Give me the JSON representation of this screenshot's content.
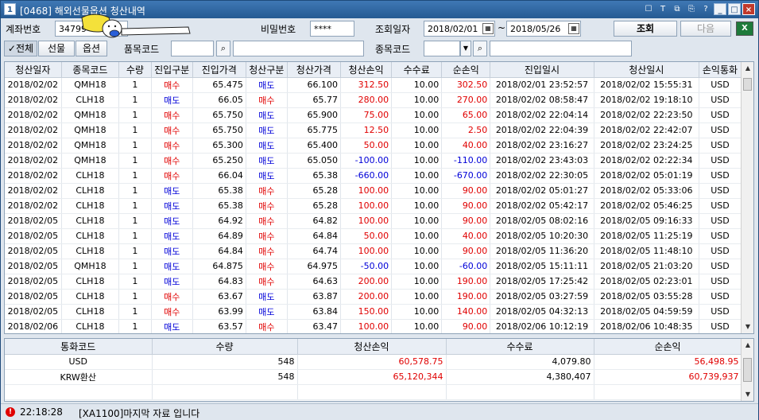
{
  "window": {
    "icon_label": "1",
    "title": "[0468] 해외선물옵션 청산내역"
  },
  "titlebar_buttons": [
    "☐",
    "T",
    "⧉",
    "⎘",
    "?",
    "_",
    "□",
    "×"
  ],
  "filters": {
    "account_label": "계좌번호",
    "account_value": "34799",
    "password_label": "비밀번호",
    "password_value": "****",
    "query_date_label": "조회일자",
    "date_from": "2018/02/01",
    "date_tilde": "~",
    "date_to": "2018/05/26",
    "search_button": "조회",
    "next_button": "다음",
    "tab_all": "전체",
    "tab_futures": "선물",
    "tab_options": "옵션",
    "product_code_label": "품목코드",
    "product_code_value": "",
    "item_code_label": "종목코드",
    "item_code_value": ""
  },
  "columns": [
    "청산일자",
    "종목코드",
    "수량",
    "진입구분",
    "진입가격",
    "청산구분",
    "청산가격",
    "청산손익",
    "수수료",
    "순손익",
    "진입일시",
    "청산일시",
    "손익통화"
  ],
  "rows": [
    [
      "2018/02/02",
      "QMH18",
      "1",
      "매수",
      "65.475",
      "매도",
      "66.100",
      "312.50",
      "10.00",
      "302.50",
      "2018/02/01  23:52:57",
      "2018/02/02  15:55:31",
      "USD"
    ],
    [
      "2018/02/02",
      "CLH18",
      "1",
      "매도",
      "66.05",
      "매수",
      "65.77",
      "280.00",
      "10.00",
      "270.00",
      "2018/02/02  08:58:47",
      "2018/02/02  19:18:10",
      "USD"
    ],
    [
      "2018/02/02",
      "QMH18",
      "1",
      "매수",
      "65.750",
      "매도",
      "65.900",
      "75.00",
      "10.00",
      "65.00",
      "2018/02/02  22:04:14",
      "2018/02/02  22:23:50",
      "USD"
    ],
    [
      "2018/02/02",
      "QMH18",
      "1",
      "매수",
      "65.750",
      "매도",
      "65.775",
      "12.50",
      "10.00",
      "2.50",
      "2018/02/02  22:04:39",
      "2018/02/02  22:42:07",
      "USD"
    ],
    [
      "2018/02/02",
      "QMH18",
      "1",
      "매수",
      "65.300",
      "매도",
      "65.400",
      "50.00",
      "10.00",
      "40.00",
      "2018/02/02  23:16:27",
      "2018/02/02  23:24:25",
      "USD"
    ],
    [
      "2018/02/02",
      "QMH18",
      "1",
      "매수",
      "65.250",
      "매도",
      "65.050",
      "-100.00",
      "10.00",
      "-110.00",
      "2018/02/02  23:43:03",
      "2018/02/02  02:22:34",
      "USD"
    ],
    [
      "2018/02/02",
      "CLH18",
      "1",
      "매수",
      "66.04",
      "매도",
      "65.38",
      "-660.00",
      "10.00",
      "-670.00",
      "2018/02/02  22:30:05",
      "2018/02/02  05:01:19",
      "USD"
    ],
    [
      "2018/02/02",
      "CLH18",
      "1",
      "매도",
      "65.38",
      "매수",
      "65.28",
      "100.00",
      "10.00",
      "90.00",
      "2018/02/02  05:01:27",
      "2018/02/02  05:33:06",
      "USD"
    ],
    [
      "2018/02/02",
      "CLH18",
      "1",
      "매도",
      "65.38",
      "매수",
      "65.28",
      "100.00",
      "10.00",
      "90.00",
      "2018/02/02  05:42:17",
      "2018/02/02  05:46:25",
      "USD"
    ],
    [
      "2018/02/05",
      "CLH18",
      "1",
      "매도",
      "64.92",
      "매수",
      "64.82",
      "100.00",
      "10.00",
      "90.00",
      "2018/02/05  08:02:16",
      "2018/02/05  09:16:33",
      "USD"
    ],
    [
      "2018/02/05",
      "CLH18",
      "1",
      "매도",
      "64.89",
      "매수",
      "64.84",
      "50.00",
      "10.00",
      "40.00",
      "2018/02/05  10:20:30",
      "2018/02/05  11:25:19",
      "USD"
    ],
    [
      "2018/02/05",
      "CLH18",
      "1",
      "매도",
      "64.84",
      "매수",
      "64.74",
      "100.00",
      "10.00",
      "90.00",
      "2018/02/05  11:36:20",
      "2018/02/05  11:48:10",
      "USD"
    ],
    [
      "2018/02/05",
      "QMH18",
      "1",
      "매도",
      "64.875",
      "매수",
      "64.975",
      "-50.00",
      "10.00",
      "-60.00",
      "2018/02/05  15:11:11",
      "2018/02/05  21:03:20",
      "USD"
    ],
    [
      "2018/02/05",
      "CLH18",
      "1",
      "매도",
      "64.83",
      "매수",
      "64.63",
      "200.00",
      "10.00",
      "190.00",
      "2018/02/05  17:25:42",
      "2018/02/05  02:23:01",
      "USD"
    ],
    [
      "2018/02/05",
      "CLH18",
      "1",
      "매수",
      "63.67",
      "매도",
      "63.87",
      "200.00",
      "10.00",
      "190.00",
      "2018/02/05  03:27:59",
      "2018/02/05  03:55:28",
      "USD"
    ],
    [
      "2018/02/05",
      "CLH18",
      "1",
      "매수",
      "63.99",
      "매도",
      "63.84",
      "150.00",
      "10.00",
      "140.00",
      "2018/02/05  04:32:13",
      "2018/02/05  04:59:59",
      "USD"
    ],
    [
      "2018/02/06",
      "CLH18",
      "1",
      "매도",
      "63.57",
      "매수",
      "63.47",
      "100.00",
      "10.00",
      "90.00",
      "2018/02/06  10:12:19",
      "2018/02/06  10:48:35",
      "USD"
    ]
  ],
  "summary": {
    "columns": [
      "통화코드",
      "수량",
      "청산손익",
      "수수료",
      "순손익"
    ],
    "rows": [
      [
        "USD",
        "548",
        "60,578.75",
        "4,079.80",
        "56,498.95"
      ],
      [
        "KRW환산",
        "548",
        "65,120,344",
        "4,380,407",
        "60,739,937"
      ]
    ]
  },
  "status": {
    "error_icon": "!",
    "time": "22:18:28",
    "message": "[XA1100]마지막 자료 입니다"
  },
  "colors": {
    "buy": "#e00000",
    "sell": "#0000d8",
    "profit": "#e00000",
    "loss": "#0000d8",
    "titlebar": "#255a92"
  }
}
